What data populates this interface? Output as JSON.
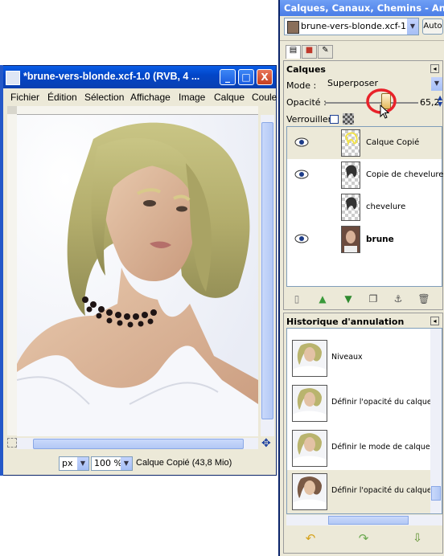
{
  "image_window": {
    "title": "*brune-vers-blonde.xcf-1.0 (RVB, 4 ...",
    "buttons": {
      "minimize": "_",
      "maximize": "□",
      "close": "X"
    },
    "menu": [
      "Fichier",
      "Édition",
      "Sélection",
      "Affichage",
      "Image",
      "Calque",
      "Coule"
    ],
    "status": {
      "unit": "px",
      "zoom": "100 %",
      "info": "Calque Copié (43,8 Mio)"
    }
  },
  "dock": {
    "title": "Calques, Canaux, Chemins - An...",
    "image_selector": "brune-vers-blonde.xcf-1",
    "auto_label": "Auto",
    "layers_panel": {
      "title": "Calques",
      "mode_label": "Mode :",
      "mode_value": "Superposer",
      "opacity_label": "Opacité :",
      "opacity_value": "65,2",
      "opacity_fraction": 0.652,
      "lock_label": "Verrouiller :",
      "layers": [
        {
          "name": "Calque Copié",
          "visible": true,
          "selected": true,
          "bold": false
        },
        {
          "name": "Copie de chevelure",
          "visible": true,
          "selected": false,
          "bold": false
        },
        {
          "name": "chevelure",
          "visible": false,
          "selected": false,
          "bold": false
        },
        {
          "name": "brune",
          "visible": true,
          "selected": false,
          "bold": true
        }
      ]
    },
    "history_panel": {
      "title": "Historique d'annulation",
      "items": [
        "Niveaux",
        "Définir l'opacité du calque",
        "Définir le mode de calque",
        "Définir l'opacité du calque"
      ]
    }
  },
  "colors": {
    "titlebar_blue": "#0a5ee8",
    "dock_title": "#4a7de6",
    "panel_bg": "#ece9d8",
    "highlight_red": "#e8222a"
  }
}
